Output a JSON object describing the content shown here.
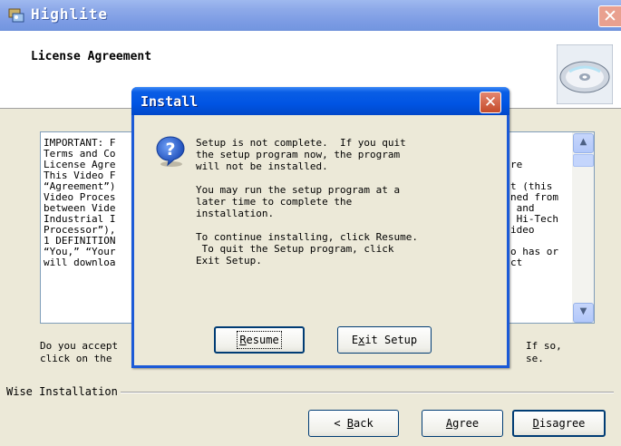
{
  "window": {
    "title": "Highlite",
    "close_glyph": "✕"
  },
  "header": {
    "title": "License Agreement"
  },
  "license": {
    "lines_left": [
      "IMPORTANT: F",
      "Terms and Co",
      "License Agre",
      "This Video F",
      "“Agreement”)",
      "Video Proces",
      "between Vide",
      "Industrial I",
      "Processor”),",
      "1 DEFINITION",
      "“You,” “Your",
      "will downloa"
    ],
    "lines_right": [
      "",
      "re",
      "",
      "t (this",
      "ned from",
      " and",
      " Hi-Tech",
      "ideo",
      "",
      "",
      "o has or",
      "ct"
    ],
    "scroll_up_glyph": "▲",
    "scroll_down_glyph": "▼"
  },
  "question": {
    "left_line1": "Do you accept",
    "left_line2": "click on the",
    "right_line1": "If so,",
    "right_line2": "se."
  },
  "footer": {
    "group_label": "Wise Installation",
    "back_label_prefix": "< ",
    "back_label_u": "B",
    "back_label_rest": "ack",
    "agree_label_u": "A",
    "agree_label_rest": "gree",
    "disagree_label_u": "D",
    "disagree_label_rest": "isagree"
  },
  "dialog": {
    "title": "Install",
    "close_glyph": "✕",
    "icon": "question-icon",
    "message": "Setup is not complete.  If you quit\nthe setup program now, the program\nwill not be installed.\n\nYou may run the setup program at a\nlater time to complete the\ninstallation.\n\nTo continue installing, click Resume.\n To quit the Setup program, click\nExit Setup.",
    "resume_u": "R",
    "resume_rest": "esume",
    "exit_pre": "E",
    "exit_u": "x",
    "exit_rest": "it Setup"
  },
  "colors": {
    "dialog_title_blue": "#0054e3",
    "main_title_blue": "#7d9ce4",
    "panel_bg": "#ece9d8"
  }
}
